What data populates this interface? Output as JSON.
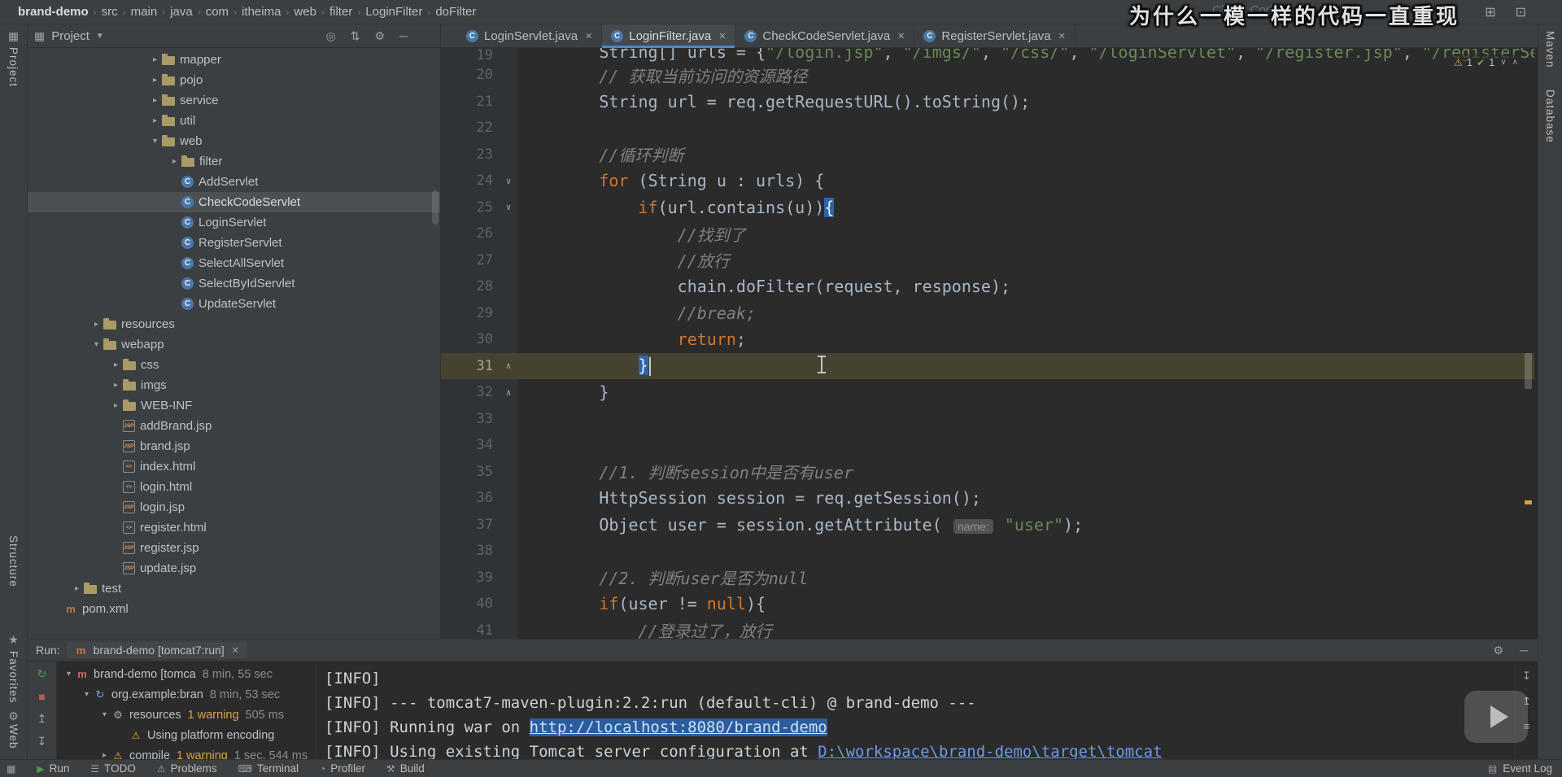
{
  "watermark": {
    "title": "为什么一模一样的代码一直重现",
    "ghost": "Check Code"
  },
  "breadcrumb": {
    "items": [
      "brand-demo",
      "src",
      "main",
      "java",
      "com",
      "itheima",
      "web",
      "filter",
      "LoginFilter",
      "doFilter"
    ]
  },
  "window_icons": [
    "share-screen",
    "presentation"
  ],
  "left_strip": {
    "project": "Project",
    "structure": "Structure",
    "favorites": "Favorites",
    "web": "Web"
  },
  "right_strip": {
    "maven": "Maven",
    "database": "Database"
  },
  "project_header": {
    "label": "Project",
    "icons": [
      "locate",
      "collapse-all",
      "settings",
      "hide"
    ]
  },
  "tabs": {
    "items": [
      {
        "label": "LoginServlet.java",
        "active": false
      },
      {
        "label": "LoginFilter.java",
        "active": true
      },
      {
        "label": "CheckCodeServlet.java",
        "active": false
      },
      {
        "label": "RegisterServlet.java",
        "active": false
      }
    ]
  },
  "project_tree": {
    "items": [
      {
        "label": "mapper",
        "icon": "folder",
        "chevron": "right",
        "level": 6
      },
      {
        "label": "pojo",
        "icon": "folder",
        "chevron": "right",
        "level": 6
      },
      {
        "label": "service",
        "icon": "folder",
        "chevron": "right",
        "level": 6
      },
      {
        "label": "util",
        "icon": "folder",
        "chevron": "right",
        "level": 6
      },
      {
        "label": "web",
        "icon": "folder",
        "chevron": "down",
        "level": 6
      },
      {
        "label": "filter",
        "icon": "folder",
        "chevron": "right",
        "level": 7
      },
      {
        "label": "AddServlet",
        "icon": "class",
        "chevron": "none",
        "level": 7
      },
      {
        "label": "CheckCodeServlet",
        "icon": "class",
        "chevron": "none",
        "level": 7,
        "selected": true
      },
      {
        "label": "LoginServlet",
        "icon": "class",
        "chevron": "none",
        "level": 7
      },
      {
        "label": "RegisterServlet",
        "icon": "class",
        "chevron": "none",
        "level": 7
      },
      {
        "label": "SelectAllServlet",
        "icon": "class",
        "chevron": "none",
        "level": 7
      },
      {
        "label": "SelectByIdServlet",
        "icon": "class",
        "chevron": "none",
        "level": 7
      },
      {
        "label": "UpdateServlet",
        "icon": "class",
        "chevron": "none",
        "level": 7
      },
      {
        "label": "resources",
        "icon": "folder",
        "chevron": "right",
        "level": 3
      },
      {
        "label": "webapp",
        "icon": "folder",
        "chevron": "down",
        "level": 3
      },
      {
        "label": "css",
        "icon": "folder",
        "chevron": "right",
        "level": 4
      },
      {
        "label": "imgs",
        "icon": "folder",
        "chevron": "right",
        "level": 4
      },
      {
        "label": "WEB-INF",
        "icon": "folder",
        "chevron": "right",
        "level": 4
      },
      {
        "label": "addBrand.jsp",
        "icon": "jsp",
        "chevron": "none",
        "level": 4
      },
      {
        "label": "brand.jsp",
        "icon": "jsp",
        "chevron": "none",
        "level": 4
      },
      {
        "label": "index.html",
        "icon": "html",
        "chevron": "none",
        "level": 4
      },
      {
        "label": "login.html",
        "icon": "html",
        "chevron": "none",
        "level": 4
      },
      {
        "label": "login.jsp",
        "icon": "jsp",
        "chevron": "none",
        "level": 4
      },
      {
        "label": "register.html",
        "icon": "html",
        "chevron": "none",
        "level": 4
      },
      {
        "label": "register.jsp",
        "icon": "jsp",
        "chevron": "none",
        "level": 4
      },
      {
        "label": "update.jsp",
        "icon": "jsp",
        "chevron": "none",
        "level": 4
      },
      {
        "label": "test",
        "icon": "folder",
        "chevron": "right",
        "level": 2
      },
      {
        "label": "pom.xml",
        "icon": "maven",
        "chevron": "none",
        "level": 1
      }
    ]
  },
  "editor": {
    "inspections": {
      "warnings": "1",
      "passed": "1"
    },
    "lines": [
      {
        "n": "19",
        "clip": true,
        "seg": [
          {
            "t": "        String[] urls = {",
            "c": "p"
          },
          {
            "t": "\"/login.jsp\"",
            "c": "s"
          },
          {
            "t": ", ",
            "c": "p"
          },
          {
            "t": "\"/imgs/\"",
            "c": "s"
          },
          {
            "t": ", ",
            "c": "p"
          },
          {
            "t": "\"/css/\"",
            "c": "s"
          },
          {
            "t": ", ",
            "c": "p"
          },
          {
            "t": "\"/loginServlet\"",
            "c": "s"
          },
          {
            "t": ", ",
            "c": "p"
          },
          {
            "t": "\"/register.jsp\"",
            "c": "s"
          },
          {
            "t": ", ",
            "c": "p"
          },
          {
            "t": "\"/registerServlet\"",
            "c": "s"
          },
          {
            "t": "};",
            "c": "p"
          }
        ]
      },
      {
        "n": "20",
        "seg": [
          {
            "t": "        ",
            "c": "p"
          },
          {
            "t": "// 获取当前访问的资源路径",
            "c": "c"
          }
        ]
      },
      {
        "n": "21",
        "seg": [
          {
            "t": "        String url = req.getRequestURL().toString();",
            "c": "p"
          }
        ]
      },
      {
        "n": "22",
        "seg": []
      },
      {
        "n": "23",
        "seg": [
          {
            "t": "        ",
            "c": "p"
          },
          {
            "t": "//循环判断",
            "c": "c"
          }
        ]
      },
      {
        "n": "24",
        "fold": "down",
        "seg": [
          {
            "t": "        ",
            "c": "p"
          },
          {
            "t": "for",
            "c": "k"
          },
          {
            "t": " (String u : urls) {",
            "c": "p"
          }
        ]
      },
      {
        "n": "25",
        "fold": "down",
        "seg": [
          {
            "t": "            ",
            "c": "p"
          },
          {
            "t": "if",
            "c": "k"
          },
          {
            "t": "(url.contains(u))",
            "c": "p"
          },
          {
            "t": "{",
            "c": "b"
          }
        ]
      },
      {
        "n": "26",
        "seg": [
          {
            "t": "                ",
            "c": "p"
          },
          {
            "t": "//找到了",
            "c": "c"
          }
        ]
      },
      {
        "n": "27",
        "seg": [
          {
            "t": "                ",
            "c": "p"
          },
          {
            "t": "//放行",
            "c": "c"
          }
        ]
      },
      {
        "n": "28",
        "seg": [
          {
            "t": "                chain.doFilter(request, response);",
            "c": "p"
          }
        ]
      },
      {
        "n": "29",
        "seg": [
          {
            "t": "                ",
            "c": "p"
          },
          {
            "t": "//break;",
            "c": "c"
          }
        ]
      },
      {
        "n": "30",
        "seg": [
          {
            "t": "                ",
            "c": "p"
          },
          {
            "t": "return",
            "c": "k"
          },
          {
            "t": ";",
            "c": "p"
          }
        ]
      },
      {
        "n": "31",
        "cur": true,
        "fold": "up",
        "caret": true,
        "seg": [
          {
            "t": "            ",
            "c": "p"
          },
          {
            "t": "}",
            "c": "b"
          }
        ]
      },
      {
        "n": "32",
        "fold": "up",
        "seg": [
          {
            "t": "        }",
            "c": "p"
          }
        ]
      },
      {
        "n": "33",
        "seg": []
      },
      {
        "n": "34",
        "seg": []
      },
      {
        "n": "35",
        "seg": [
          {
            "t": "        ",
            "c": "p"
          },
          {
            "t": "//1. 判断session中是否有user",
            "c": "c"
          }
        ]
      },
      {
        "n": "36",
        "seg": [
          {
            "t": "        HttpSession session = req.getSession();",
            "c": "p"
          }
        ]
      },
      {
        "n": "37",
        "seg": [
          {
            "t": "        Object user = session.getAttribute( ",
            "c": "p"
          },
          {
            "t": "name:",
            "c": "h"
          },
          {
            "t": " ",
            "c": "p"
          },
          {
            "t": "\"user\"",
            "c": "s"
          },
          {
            "t": ");",
            "c": "p"
          }
        ]
      },
      {
        "n": "38",
        "seg": []
      },
      {
        "n": "39",
        "seg": [
          {
            "t": "        ",
            "c": "p"
          },
          {
            "t": "//2. 判断user是否为null",
            "c": "c"
          }
        ]
      },
      {
        "n": "40",
        "seg": [
          {
            "t": "        ",
            "c": "p"
          },
          {
            "t": "if",
            "c": "k"
          },
          {
            "t": "(user != ",
            "c": "p"
          },
          {
            "t": "null",
            "c": "k"
          },
          {
            "t": "){",
            "c": "p"
          }
        ]
      },
      {
        "n": "41",
        "seg": [
          {
            "t": "            ",
            "c": "p"
          },
          {
            "t": "//登录过了，放行",
            "c": "c"
          }
        ]
      }
    ]
  },
  "run_panel": {
    "label": "Run:",
    "tab": "brand-demo [tomcat7:run]",
    "tool_icons": [
      "rerun",
      "stop",
      "scroll-up",
      "scroll-down",
      "filter"
    ],
    "header_icons": [
      "settings",
      "hide"
    ],
    "console_tool_icons": [
      "scroll-to-end",
      "scroll-to-top",
      "soft-wrap"
    ],
    "tree": [
      {
        "level": 0,
        "chevron": "down",
        "icon": "maven",
        "label": "brand-demo [tomca",
        "time": "8 min, 55 sec"
      },
      {
        "level": 1,
        "chevron": "down",
        "icon": "goal",
        "label": "org.example:bran",
        "time": "8 min, 53 sec"
      },
      {
        "level": 2,
        "chevron": "down",
        "icon": "gear",
        "label": "resources",
        "warn": "1 warning",
        "time": "505 ms"
      },
      {
        "level": 3,
        "chevron": "none",
        "icon": "warning",
        "label": "Using plat­form encoding"
      },
      {
        "level": 2,
        "chevron": "right",
        "icon": "warning",
        "label": "compile",
        "warn": "1 warning",
        "time": "1 sec, 544 ms"
      }
    ],
    "console": [
      [
        {
          "t": "[INFO]",
          "c": "p"
        }
      ],
      [
        {
          "t": "[INFO] --- tomcat7-maven-plugin:2.2:run (default-cli) @ brand-demo ---",
          "c": "p"
        }
      ],
      [
        {
          "t": "[INFO] Running war on ",
          "c": "p"
        },
        {
          "t": "http://localhost:8080/brand-demo",
          "c": "link-sel"
        }
      ],
      [
        {
          "t": "[INFO] Using existing Tomcat server configuration at ",
          "c": "p"
        },
        {
          "t": "D:\\workspace\\brand-demo\\target\\tomcat",
          "c": "link"
        }
      ]
    ]
  },
  "status_bar": {
    "items": [
      {
        "icon": "play",
        "label": "Run"
      },
      {
        "icon": "todo",
        "label": "TODO"
      },
      {
        "icon": "problems",
        "label": "Problems"
      },
      {
        "icon": "terminal",
        "label": "Terminal"
      },
      {
        "icon": "profiler",
        "label": "Profiler"
      },
      {
        "icon": "build",
        "label": "Build"
      }
    ],
    "right": {
      "icon": "event-log",
      "label": "Event Log"
    }
  }
}
